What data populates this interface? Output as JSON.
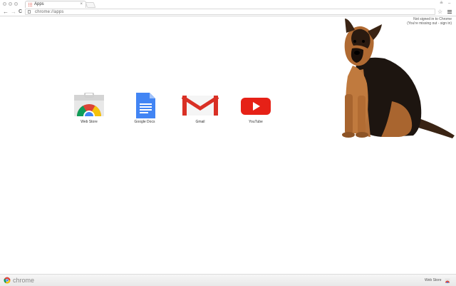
{
  "tab": {
    "title": "Apps",
    "close": "×"
  },
  "toolbar": {
    "back_glyph": "←",
    "forward_glyph": "→",
    "reload_glyph": "C",
    "url": "chrome://apps",
    "star_glyph": "☆"
  },
  "window_controls": {
    "user": "≗",
    "minimize": "–"
  },
  "signin": {
    "line1": "Not signed in to Chrome",
    "line2": "(You're missing out - sign in)"
  },
  "apps": [
    {
      "label": "Web Store",
      "icon": "web-store-icon"
    },
    {
      "label": "Google Docs",
      "icon": "google-docs-icon"
    },
    {
      "label": "Gmail",
      "icon": "gmail-icon"
    },
    {
      "label": "YouTube",
      "icon": "youtube-icon"
    }
  ],
  "footer": {
    "brand": "chrome",
    "webstore_link": "Web Store"
  },
  "colors": {
    "chrome_red": "#db4437",
    "chrome_yellow": "#f4c20d",
    "chrome_green": "#0f9d58",
    "chrome_blue": "#4285f4",
    "docs_blue": "#4285f4",
    "gmail_red": "#d93025",
    "youtube_red": "#e62117"
  }
}
